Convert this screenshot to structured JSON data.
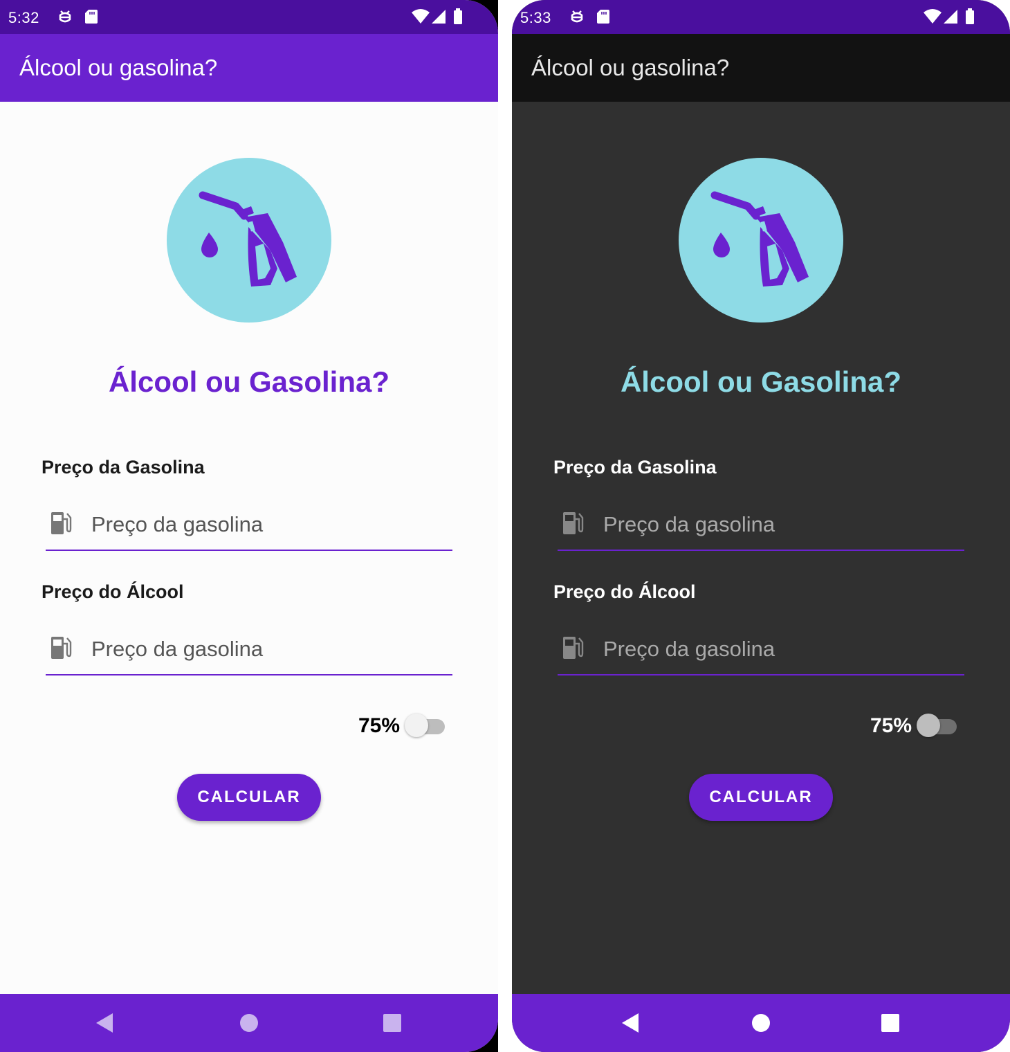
{
  "colors": {
    "primary": "#6a22cf",
    "primary_dark": "#4a0f9e",
    "accent": "#8edbe6",
    "dark_background": "#303030",
    "dark_appbar": "#121212"
  },
  "screens": [
    {
      "theme": "light",
      "status_time": "5:32",
      "app_title": "Álcool ou gasolina?",
      "heading": "Álcool ou Gasolina?",
      "gasoline_label": "Preço da Gasolina",
      "gasoline_placeholder": "Preço da gasolina",
      "alcohol_label": "Preço do Álcool",
      "alcohol_placeholder": "Preço da gasolina",
      "switch_label": "75%",
      "switch_on": false,
      "button_label": "CALCULAR"
    },
    {
      "theme": "dark",
      "status_time": "5:33",
      "app_title": "Álcool ou gasolina?",
      "heading": "Álcool ou Gasolina?",
      "gasoline_label": "Preço da Gasolina",
      "gasoline_placeholder": "Preço da gasolina",
      "alcohol_label": "Preço do Álcool",
      "alcohol_placeholder": "Preço da gasolina",
      "switch_label": "75%",
      "switch_on": false,
      "button_label": "CALCULAR"
    }
  ],
  "icons": {
    "logo": "fuel-nozzle-icon",
    "input": "gas-pump-icon",
    "status": [
      "debug-icon",
      "sd-card-icon",
      "wifi-icon",
      "signal-icon",
      "battery-icon"
    ],
    "nav": [
      "back-icon",
      "home-icon",
      "recents-icon"
    ]
  }
}
